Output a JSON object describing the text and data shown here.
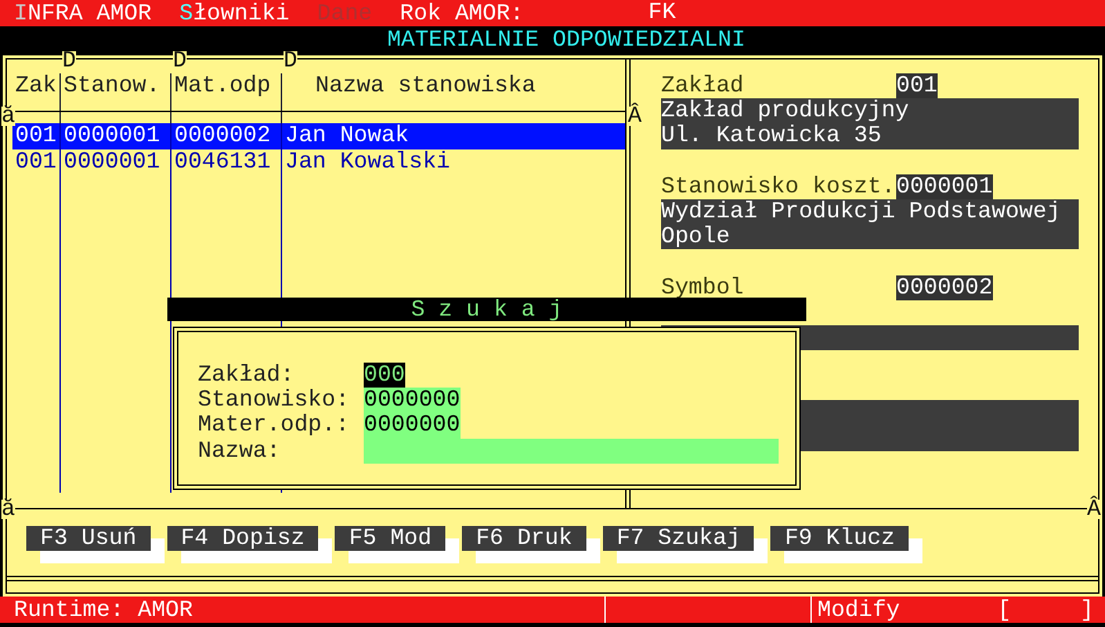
{
  "menu": {
    "items": [
      {
        "label": "INFRA AMOR",
        "kind": "active",
        "disabled": false
      },
      {
        "label": "Słowniki",
        "kind": "hotkey",
        "disabled": false
      },
      {
        "label": "Dane",
        "kind": "plain",
        "disabled": true
      },
      {
        "label": "Rok AMOR:",
        "kind": "plain",
        "disabled": false
      }
    ],
    "year": "FK"
  },
  "title": "MATERIALNIE ODPOWIEDZIALNI",
  "frame_marks": {
    "column_marks": [
      "D",
      "D",
      "D"
    ],
    "left_end": "ă",
    "right_end": "Â",
    "bottom_left_end": "ă",
    "bottom_right_end": "Â"
  },
  "table": {
    "columns": [
      "Zak",
      "Stanow.",
      "Mat.odp",
      "Nazwa stanowiska"
    ],
    "rows": [
      {
        "cells": [
          "001",
          "0000001",
          "0000002",
          "Jan Nowak"
        ],
        "selected": true
      },
      {
        "cells": [
          "001",
          "0000001",
          "0046131",
          "Jan Kowalski"
        ],
        "selected": false
      }
    ]
  },
  "details": [
    {
      "label": "Zakład",
      "value": "001",
      "lines": [
        "Zakład produkcyjny",
        "Ul. Katowicka 35"
      ]
    },
    {
      "label": "Stanowisko koszt.",
      "value": "0000001",
      "lines": [
        "Wydział Produkcji Podstawowej",
        "Opole"
      ]
    },
    {
      "label": "Symbol",
      "value": "0000002"
    }
  ],
  "dialog": {
    "title": "S z u k a j",
    "fields": [
      {
        "label": "Zakład:",
        "value": "000",
        "focused": true
      },
      {
        "label": "Stanowisko:",
        "value": "0000000",
        "focused": false
      },
      {
        "label": "Mater.odp.:",
        "value": "0000000",
        "focused": false
      },
      {
        "label": "Nazwa:",
        "focused": false
      }
    ]
  },
  "function_keys": [
    "F3 Usuń",
    "F4 Dopisz",
    "F5 Mod",
    "F6 Druk",
    "F7 Szukaj",
    "F9 Klucz"
  ],
  "status_bar": {
    "left": "Runtime: AMOR",
    "mode": "Modify",
    "indicator": "[     ]"
  }
}
